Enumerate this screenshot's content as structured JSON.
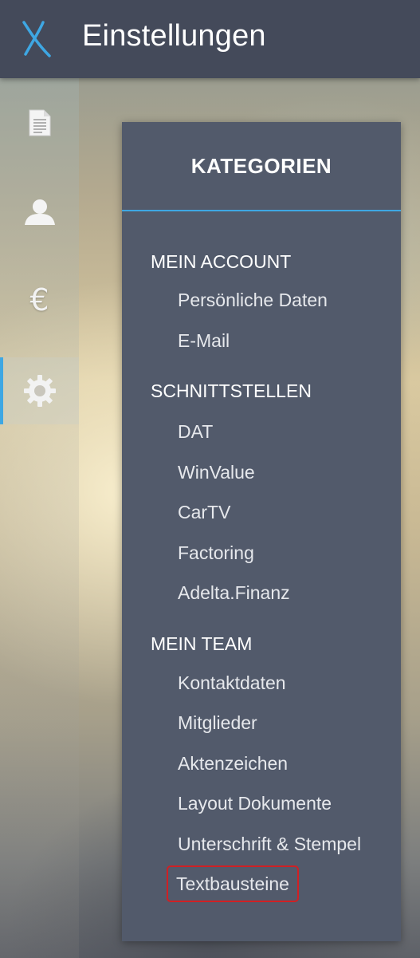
{
  "app": {
    "title": "Einstellungen",
    "logo_icon": "x-logo-icon",
    "accent_color": "#3ea7e3",
    "highlight_color": "#d02024"
  },
  "sidebar": {
    "items": [
      {
        "name": "documents",
        "icon": "document-icon",
        "active": false
      },
      {
        "name": "contacts",
        "icon": "user-icon",
        "active": false
      },
      {
        "name": "billing",
        "icon": "euro-icon",
        "glyph": "€",
        "active": false
      },
      {
        "name": "settings",
        "icon": "gear-icon",
        "active": true
      }
    ]
  },
  "panel": {
    "title": "KATEGORIEN",
    "sections": [
      {
        "title": "MEIN ACCOUNT",
        "items": [
          "Persönliche Daten",
          "E-Mail"
        ]
      },
      {
        "title": "SCHNITTSTELLEN",
        "items": [
          "DAT",
          "WinValue",
          "CarTV",
          "Factoring",
          "Adelta.Finanz"
        ]
      },
      {
        "title": "MEIN TEAM",
        "items": [
          "Kontaktdaten",
          "Mitglieder",
          "Aktenzeichen",
          "Layout Dokumente",
          "Unterschrift & Stempel",
          "Textbausteine"
        ]
      }
    ],
    "highlighted_item": "Textbausteine"
  }
}
